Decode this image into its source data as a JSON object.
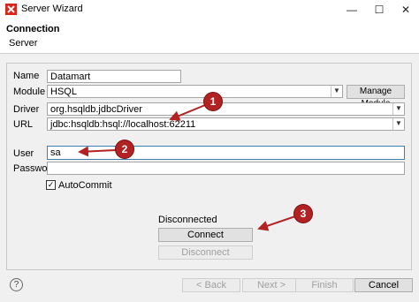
{
  "window": {
    "title": "Server Wizard",
    "min_glyph": "—",
    "max_glyph": "☐",
    "close_glyph": "✕"
  },
  "header": {
    "title": "Connection",
    "subtitle": "Server"
  },
  "form": {
    "name_label": "Name",
    "name_value": "Datamart",
    "module_label": "Module",
    "module_value": "HSQL",
    "manage_module_label": "Manage Module",
    "driver_label": "Driver",
    "driver_value": "org.hsqldb.jdbcDriver",
    "url_label": "URL",
    "url_value": "jdbc:hsqldb:hsql://localhost:62211",
    "user_label": "User",
    "user_value": "sa",
    "password_label": "Password",
    "password_value": "",
    "autocommit_label": "AutoCommit",
    "autocommit_checked": true,
    "status_text": "Disconnected",
    "connect_label": "Connect",
    "disconnect_label": "Disconnect"
  },
  "footer": {
    "help_glyph": "?",
    "back_label": "< Back",
    "next_label": "Next >",
    "finish_label": "Finish",
    "cancel_label": "Cancel"
  },
  "callouts": [
    "1",
    "2",
    "3"
  ],
  "colors": {
    "callout": "#b32222",
    "focus_border": "#3c7fb1"
  }
}
